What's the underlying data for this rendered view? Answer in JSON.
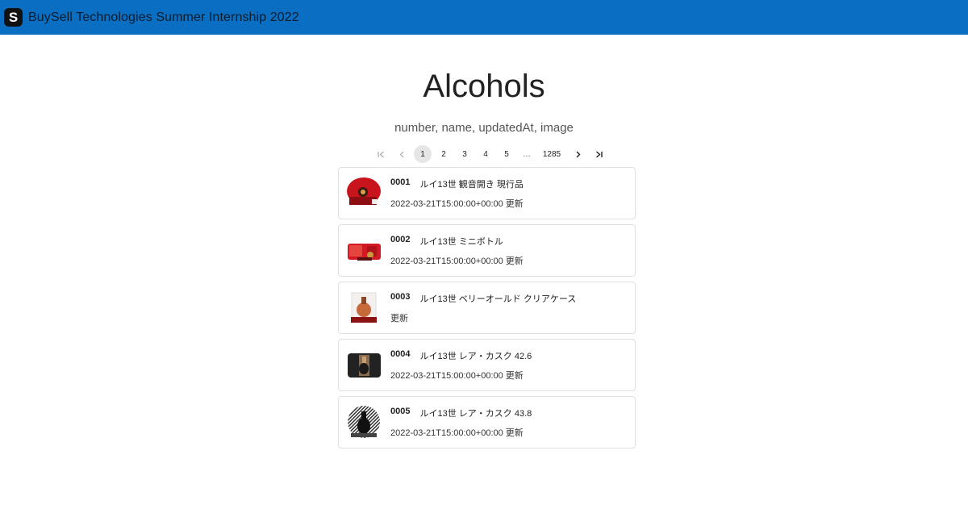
{
  "app": {
    "title": "BuySell Technologies Summer Internship 2022",
    "logo_letter": "S"
  },
  "page": {
    "heading": "Alcohols",
    "subheading": "number, name, updatedAt, image"
  },
  "pagination": {
    "first_icon": "first-page-icon",
    "prev_icon": "chevron-left-icon",
    "pages": [
      "1",
      "2",
      "3",
      "4",
      "5"
    ],
    "ellipsis": "…",
    "last_page": "1285",
    "next_icon": "chevron-right-icon",
    "last_icon": "last-page-icon",
    "selected": "1"
  },
  "items": [
    {
      "number": "0001",
      "name": "ルイ13世 観音開き 現行品",
      "updated": "2022-03-21T15:00:00+00:00 更新",
      "image_icon": "bottle-red-box-image"
    },
    {
      "number": "0002",
      "name": "ルイ13世 ミニボトル",
      "updated": "2022-03-21T15:00:00+00:00 更新",
      "image_icon": "mini-bottle-red-case-image"
    },
    {
      "number": "0003",
      "name": "ルイ13世 ベリーオールド クリアケース",
      "updated": "更新",
      "image_icon": "clear-case-bottle-image"
    },
    {
      "number": "0004",
      "name": "ルイ13世 レア・カスク 42.6",
      "updated": "2022-03-21T15:00:00+00:00 更新",
      "image_icon": "black-case-bottle-image"
    },
    {
      "number": "0005",
      "name": "ルイ13世 レア・カスク 43.8",
      "updated": "2022-03-21T15:00:00+00:00 更新",
      "image_icon": "striped-case-bottle-image"
    }
  ],
  "colors": {
    "appbar": "#0a6fc2",
    "selected_page": "#e6e6e6"
  }
}
